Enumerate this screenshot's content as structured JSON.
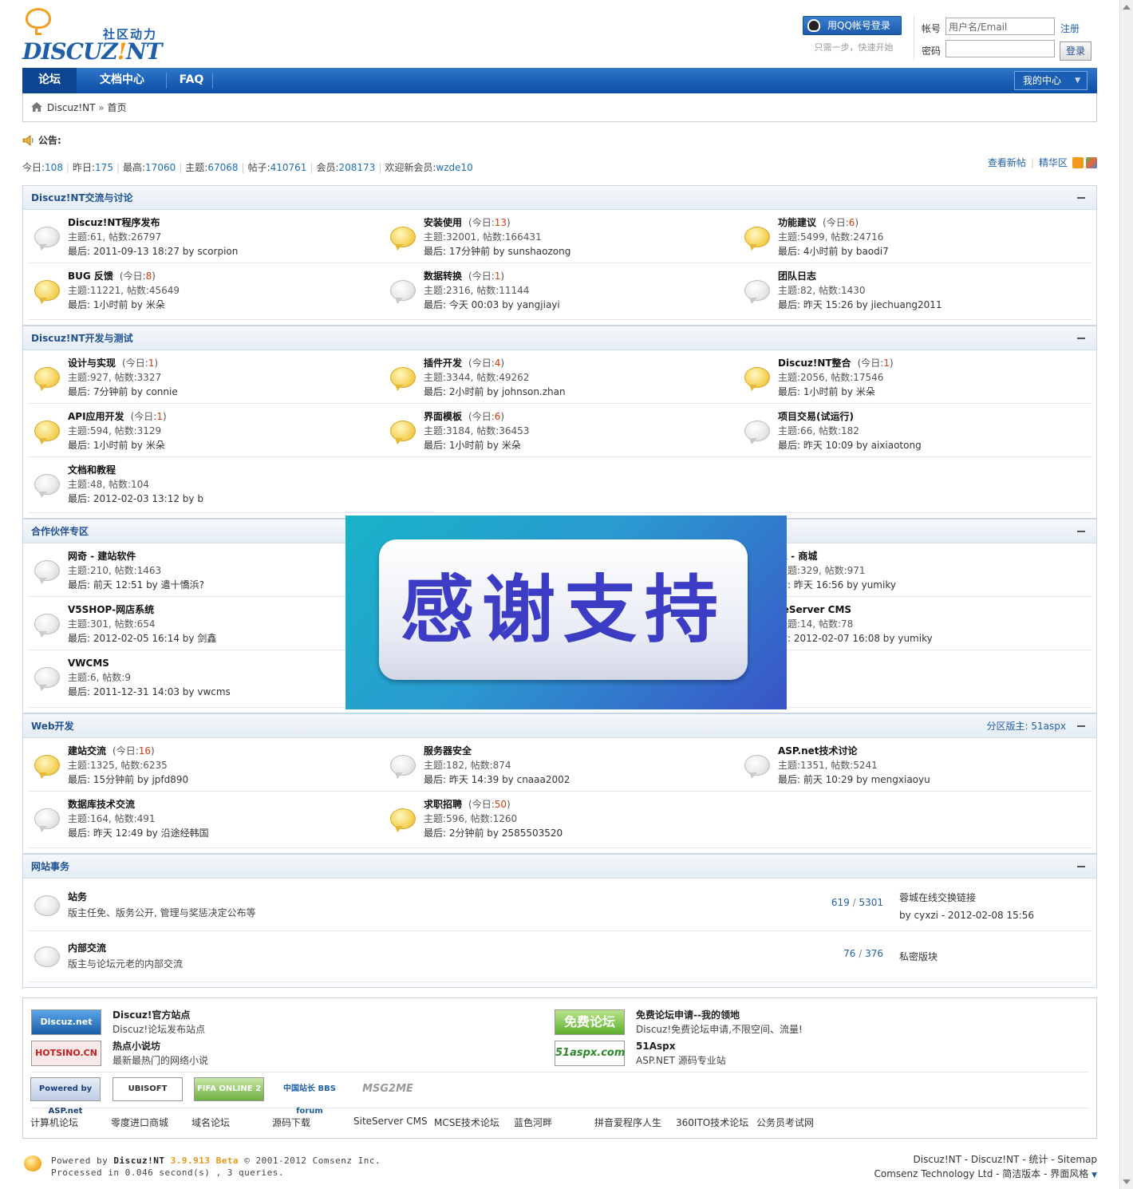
{
  "header": {
    "logo_cn": "社区动力",
    "logo_en_a": "DISCUZ",
    "logo_en_b": "!",
    "logo_en_c": "NT",
    "qq_login": "用QQ帐号登录",
    "qq_tip": "只需一步，快速开始",
    "account_label": "帐号",
    "account_placeholder": "用户名/Email",
    "register": "注册",
    "password_label": "密码",
    "login_button": "登录"
  },
  "nav": {
    "items": [
      "论坛",
      "文档中心",
      "FAQ"
    ],
    "my_center": "我的中心"
  },
  "breadcrumb": {
    "root": "Discuz!NT",
    "sep": "»",
    "current": "首页"
  },
  "notice": "公告:",
  "stats": {
    "today_label": "今日:",
    "today": "108",
    "yesterday_label": "昨日:",
    "yesterday": "175",
    "max_label": "最高:",
    "max": "17060",
    "topics_label": "主题:",
    "topics": "67068",
    "posts_label": "帖子:",
    "posts": "410761",
    "members_label": "会员:",
    "members": "208173",
    "newmember_label": "欢迎新会员:",
    "newmember": "wzde10",
    "view_new": "查看新帖",
    "digest": "精华区"
  },
  "sections": [
    {
      "title": "Discuz!NT交流与讨论",
      "forums": [
        {
          "name": "Discuz!NT程序发布",
          "today": "",
          "stat": "主题:61, 帖数:26797",
          "last": "最后: 2011-09-13 18:27 by scorpion",
          "new": false
        },
        {
          "name": "安装使用",
          "today": "13",
          "stat": "主题:32001, 帖数:166431",
          "last": "最后: 17分钟前  by sunshaozong",
          "new": true
        },
        {
          "name": "功能建议",
          "today": "6",
          "stat": "主题:5499, 帖数:24716",
          "last": "最后: 4小时前  by baodi7",
          "new": true
        },
        {
          "name": "BUG 反馈",
          "today": "8",
          "stat": "主题:11221, 帖数:45649",
          "last": "最后: 1小时前  by 米朵",
          "new": true
        },
        {
          "name": "数据转换",
          "today": "1",
          "stat": "主题:2316, 帖数:11144",
          "last": "最后: 今天  00:03 by yangjiayi",
          "new": false
        },
        {
          "name": "团队日志",
          "today": "",
          "stat": "主题:82, 帖数:1430",
          "last": "最后: 昨天  15:26 by jiechuang2011",
          "new": false
        }
      ]
    },
    {
      "title": "Discuz!NT开发与测试",
      "forums": [
        {
          "name": "设计与实现",
          "today": "1",
          "stat": "主题:927, 帖数:3327",
          "last": "最后: 7分钟前  by connie",
          "new": true
        },
        {
          "name": "插件开发",
          "today": "4",
          "stat": "主题:3344, 帖数:49262",
          "last": "最后: 2小时前  by johnson.zhan",
          "new": true
        },
        {
          "name": "Discuz!NT整合",
          "today": "1",
          "stat": "主题:2056, 帖数:17546",
          "last": "最后: 1小时前  by 米朵",
          "new": true
        },
        {
          "name": "API应用开发",
          "today": "1",
          "stat": "主题:594, 帖数:3129",
          "last": "最后: 1小时前  by 米朵",
          "new": true
        },
        {
          "name": "界面模板",
          "today": "6",
          "stat": "主题:3184, 帖数:36453",
          "last": "最后: 1小时前  by 米朵",
          "new": true
        },
        {
          "name": "项目交易(试运行)",
          "today": "",
          "stat": "主题:66, 帖数:182",
          "last": "最后: 昨天  10:09 by aixiaotong",
          "new": false
        },
        {
          "name": "文档和教程",
          "today": "",
          "stat": "主题:48, 帖数:104",
          "last": "最后: 2012-02-03 13:12 by b",
          "new": false
        }
      ]
    },
    {
      "title": "合作伙伴专区",
      "forums": [
        {
          "name": "网奇 - 建站软件",
          "today": "",
          "stat": "主题:210, 帖数:1463",
          "last": "最后: 前天  12:51 by 遣十憍浜?",
          "new": false
        },
        {
          "name": "想 - 商城",
          "today": "",
          "stat": "主题:329, 帖数:971",
          "last": "后: 昨天  16:56 by yumiky",
          "new": false
        },
        {
          "name": "V5SHOP-网店系统",
          "today": "",
          "stat": "主题:301, 帖数:654",
          "last": "最后: 2012-02-05 16:14 by 剑鑫",
          "new": false
        },
        {
          "name": "teServer CMS",
          "today": "",
          "stat": "主题:14, 帖数:78",
          "last": "后: 2012-02-07 16:08 by yumiky",
          "new": false
        },
        {
          "name": "VWCMS",
          "today": "",
          "stat": "主题:6, 帖数:9",
          "last": "最后: 2011-12-31 14:03 by vwcms",
          "new": false
        }
      ]
    },
    {
      "title": "Web开发",
      "moderator": "分区版主: 51aspx",
      "forums": [
        {
          "name": "建站交流",
          "today": "16",
          "stat": "主题:1325, 帖数:6235",
          "last": "最后: 15分钟前  by jpfd890",
          "new": true
        },
        {
          "name": "服务器安全",
          "today": "",
          "stat": "主题:182, 帖数:874",
          "last": "最后: 昨天  14:39 by cnaaa2002",
          "new": false
        },
        {
          "name": "ASP.net技术讨论",
          "today": "",
          "stat": "主题:1351, 帖数:5241",
          "last": "最后: 前天  10:29 by mengxiaoyu",
          "new": false
        },
        {
          "name": "数据库技术交流",
          "today": "",
          "stat": "主题:164, 帖数:491",
          "last": "最后: 昨天  12:49 by 沿途经韩国",
          "new": false
        },
        {
          "name": "求职招聘",
          "today": "50",
          "stat": "主题:596, 帖数:1260",
          "last": "最后: 2分钟前  by 2585503520",
          "new": true
        }
      ]
    },
    {
      "title": "网站事务",
      "rows": [
        {
          "name": "站务",
          "desc": "版主任免、版务公开, 管理与奖惩决定公布等",
          "topics": "619",
          "posts": "5301",
          "last_title": "蓉城在线交换链接",
          "last_by": "by cyxzi - 2012-02-08 15:56"
        },
        {
          "name": "内部交流",
          "desc": "版主与论坛元老的内部交流",
          "topics": "76",
          "posts": "376",
          "last_title": "私密版块",
          "last_by": ""
        }
      ]
    }
  ],
  "today_prefix": "(今日:",
  "today_suffix": ")",
  "links": {
    "items": [
      {
        "logo": "Discuz.net",
        "title": "Discuz!官方站点",
        "desc": "Discuz!论坛发布站点"
      },
      {
        "logo": "HOTSINO.CN",
        "title": "热点小说坊",
        "desc": "最新最热门的网络小说"
      },
      {
        "logo": "免费论坛",
        "title": "免费论坛申请--我的领地",
        "desc": "Discuz!免费论坛申请,不限空间、流量!"
      },
      {
        "logo": "51aspx.com",
        "title": "51Aspx",
        "desc": "ASP.NET 源码专业站"
      }
    ],
    "badges": [
      "Powered by ASP.net",
      "UBISOFT",
      "FIFA ONLINE 2",
      "中国站长 BBS forum",
      "MSG2ME"
    ],
    "text": [
      "计算机论坛",
      "零度进口商城",
      "域名论坛",
      "源码下载",
      "SiteServer CMS",
      "MCSE技术论坛",
      "蓝色河畔",
      "拼音爱程序人生",
      "360ITO技术论坛",
      "公务员考试网"
    ]
  },
  "overlay_text": "感谢支持",
  "footer": {
    "powered": "Powered by",
    "brand": "Discuz!NT",
    "version": "3.9.913 Beta",
    "copy": "© 2001-2012 Comsenz Inc.",
    "processed": "Processed in 0.046 second(s) , 3 queries.",
    "right_line1": "Discuz!NT - Discuz!NT - 统计 -  Sitemap",
    "right_line2": "Comsenz Technology Ltd - 简洁版本 - 界面风格"
  }
}
